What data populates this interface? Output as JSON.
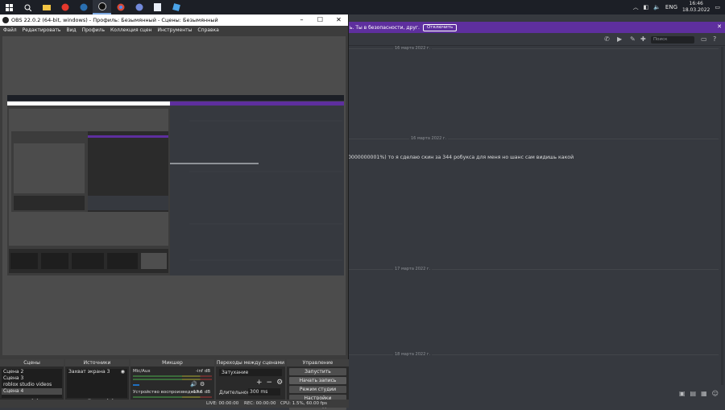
{
  "taskbar": {
    "apps": [
      "start-icon",
      "search-icon",
      "file-explorer-icon",
      "yandex-icon",
      "steam-icon",
      "obs-icon",
      "chrome-icon",
      "discord-icon",
      "notepad-icon",
      "roblox-studio-icon"
    ],
    "lang": "ENG",
    "time": "16:46",
    "date": "18.03.2022"
  },
  "discord": {
    "notice_text": "ь. Ты в безопасности, друг.",
    "notice_button": "Отключить",
    "search_placeholder": "Поиск",
    "dates": [
      "16 марта 2022 г.",
      "16 марта 2022 г.",
      "17 марта 2022 г.",
      "18 марта 2022 г."
    ],
    "message": "0000000001%) то я сделаю скин за 344 робукса для меня  но шанс сам видишь какой"
  },
  "obs": {
    "title": "OBS 22.0.2 (64-bit, windows) - Профиль: Безымянный - Сцены: Безымянный",
    "menu": [
      "Файл",
      "Редактировать",
      "Вид",
      "Профиль",
      "Коллекция сцен",
      "Инструменты",
      "Справка"
    ],
    "docks": {
      "scenes": {
        "title": "Сцены",
        "items": [
          "Сцена 2",
          "Сцена 3",
          "roblox studio videos",
          "Сцена 4"
        ]
      },
      "sources": {
        "title": "Источники",
        "items": [
          "Захват экрана 3"
        ]
      },
      "mixer": {
        "title": "Микшер",
        "mic_label": "Мic/Aux",
        "mic_db": "-inf dB",
        "desktop_label": "Устройство воспроизведения",
        "desktop_db": "-17.5 dB"
      },
      "transitions": {
        "title": "Переходы между сценами",
        "type": "Затухание",
        "duration_label": "Длительность",
        "duration": "300 ms"
      },
      "controls": {
        "title": "Управление",
        "buttons": [
          "Запустить трансляцию",
          "Начать запись",
          "Режим студии",
          "Настройки",
          "Выход"
        ]
      }
    },
    "status": {
      "live": "LIVE: 00:00:00",
      "rec": "REC: 00:00:00",
      "cpu": "CPU: 1.5%, 60.00 fps"
    }
  }
}
